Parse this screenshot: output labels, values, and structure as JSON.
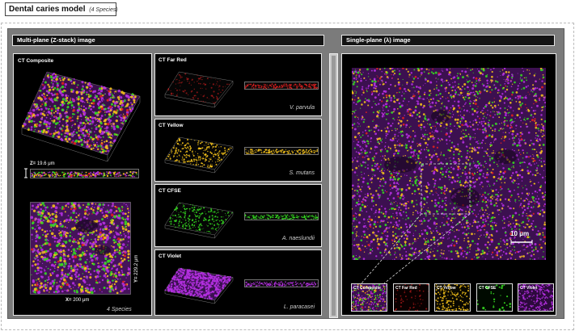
{
  "title": {
    "main": "Dental caries model",
    "sub": "(4 Species)"
  },
  "left_header": "Multi-plane (Z-stack) image",
  "right_header": "Single-plane (λ) image",
  "composite": {
    "label": "CT Composite",
    "z_label": "Z=",
    "z_value": "19.6 μm",
    "y_label": "Y=",
    "y_value": "229.2 μm",
    "x_label": "X=",
    "x_value": "200 μm",
    "species": "4 Species"
  },
  "channels": [
    {
      "label": "CT Far Red",
      "species": "V. parvula",
      "color": "#e02020"
    },
    {
      "label": "CT Yellow",
      "species": "S. mutans",
      "color": "#f2c01a"
    },
    {
      "label": "CT CFSE",
      "species": "A. naeslundii",
      "color": "#34d820"
    },
    {
      "label": "CT Violet",
      "species": "L. paracasei",
      "color": "#b430e0"
    }
  ],
  "scale_bar": "10 μm",
  "thumbnails": [
    {
      "label": "CT Composite"
    },
    {
      "label": "CT Far Red"
    },
    {
      "label": "CT Yellow"
    },
    {
      "label": "CT CFSE"
    },
    {
      "label": "CT Violet"
    }
  ]
}
